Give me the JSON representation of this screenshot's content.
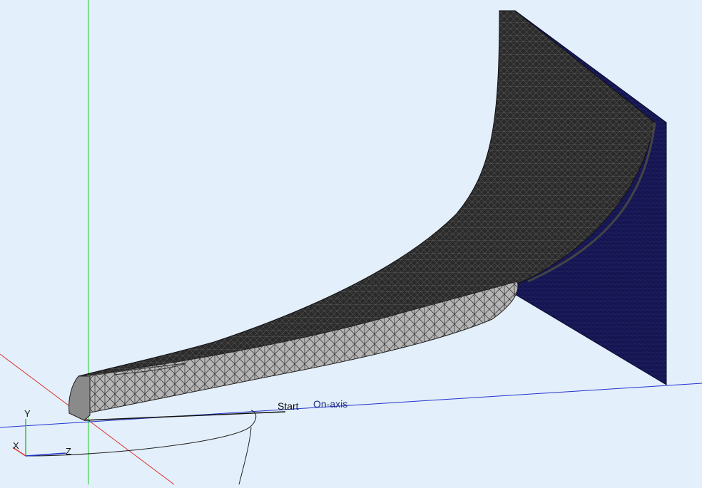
{
  "viewport": {
    "background": "#e3effb",
    "axis_colors": {
      "x": "#e03030",
      "y": "#22cc22",
      "z": "#2233cc"
    },
    "mesh_colors": {
      "face": "#b8b8b8",
      "wire": "#1a1a1a",
      "backplate": "#14144a"
    }
  },
  "labels": {
    "start": "Start",
    "on_axis": "On-axis"
  },
  "triad": {
    "x": "X",
    "y": "Y",
    "z": "Z"
  }
}
